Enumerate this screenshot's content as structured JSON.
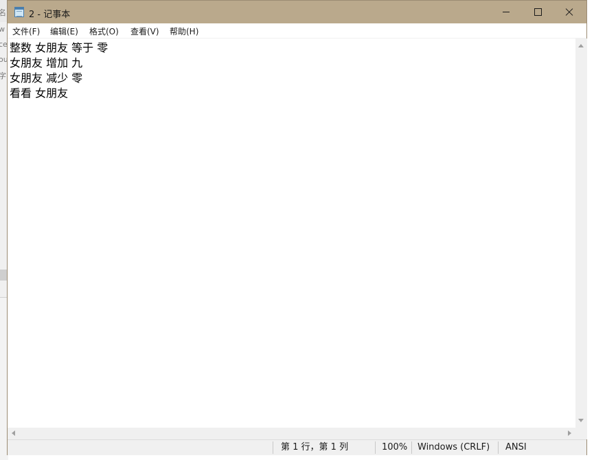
{
  "background": {
    "fragments": [
      "名",
      "w",
      "ce",
      "ou",
      "字"
    ]
  },
  "window": {
    "title": "2 - 记事本",
    "icon": "notepad-icon",
    "titlebar_color": "#baa98c"
  },
  "menu": {
    "items": [
      "文件(F)",
      "编辑(E)",
      "格式(O)",
      "查看(V)",
      "帮助(H)"
    ]
  },
  "editor": {
    "lines": [
      "整数 女朋友 等于 零",
      "女朋友 增加 九",
      "女朋友 减少 零",
      "看看 女朋友"
    ]
  },
  "status": {
    "position": "第 1 行，第 1 列",
    "zoom": "100%",
    "line_ending": "Windows (CRLF)",
    "encoding": "ANSI"
  }
}
